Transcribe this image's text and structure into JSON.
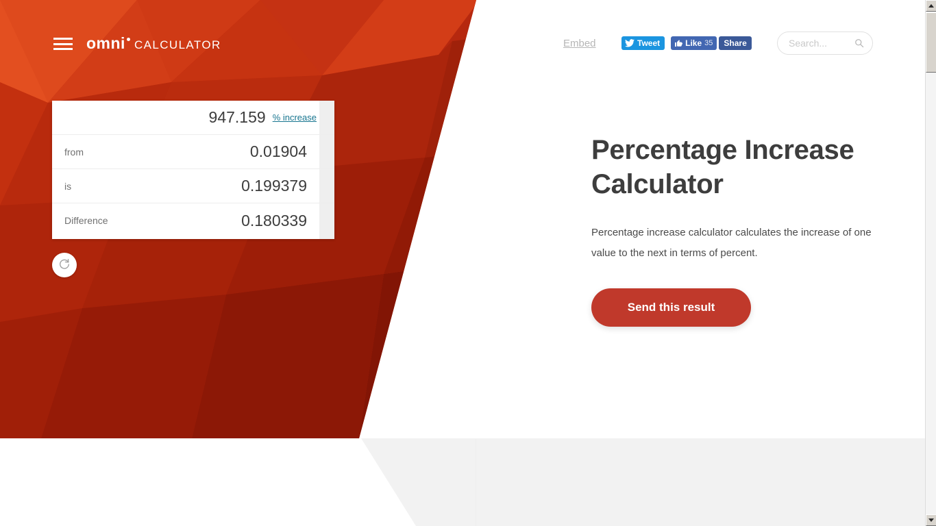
{
  "header": {
    "menu_icon": "hamburger-icon",
    "brand_primary": "omni",
    "brand_secondary": "CALCULATOR",
    "embed_label": "Embed",
    "tweet_label": "Tweet",
    "like_label": "Like",
    "like_count": "35",
    "share_label": "Share",
    "search_placeholder": "Search...",
    "search_value": "",
    "search_icon": "magnifier-icon"
  },
  "calculator": {
    "result_value": "947.159",
    "result_link": "% increase",
    "rows": [
      {
        "label": "from",
        "value": "0.01904"
      },
      {
        "label": "is",
        "value": "0.199379"
      },
      {
        "label": "Difference",
        "value": "0.180339"
      }
    ],
    "reload_icon": "refresh-icon"
  },
  "content": {
    "title": "Percentage Increase Calculator",
    "description": "Percentage increase calculator calculates the increase of one value to the next in terms of percent.",
    "send_label": "Send this result"
  },
  "colors": {
    "brand_red": "#b6280f",
    "button_red": "#c0392b",
    "link_teal": "#17758f",
    "twitter_blue": "#1b95e0",
    "facebook_blue": "#4267b2",
    "share_blue": "#3b5998",
    "footer_gray": "#f2f2f2"
  }
}
